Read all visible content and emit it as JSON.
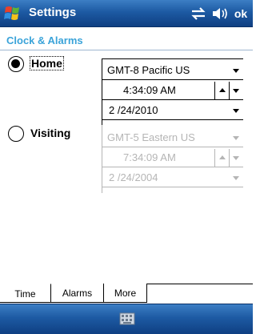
{
  "titlebar": {
    "title": "Settings",
    "ok_label": "ok",
    "start_icon": "windows-flag-icon",
    "connectivity_icon": "connectivity-icon",
    "volume_icon": "volume-icon",
    "color": "#1d5aa3"
  },
  "page": {
    "header": "Clock & Alarms",
    "header_color": "#3aa3d9"
  },
  "home": {
    "label": "Home",
    "selected": true,
    "timezone": "GMT-8 Pacific US",
    "time": "4:34:09 AM",
    "date": "2 /24/2010"
  },
  "visiting": {
    "label": "Visiting",
    "selected": false,
    "timezone": "GMT-5 Eastern US",
    "time": "7:34:09 AM",
    "date": "2 /24/2004"
  },
  "tabs": [
    {
      "label": "Time",
      "active": true
    },
    {
      "label": "Alarms",
      "active": false
    },
    {
      "label": "More",
      "active": false
    }
  ],
  "menubar": {
    "keyboard_icon": "keyboard-icon"
  }
}
